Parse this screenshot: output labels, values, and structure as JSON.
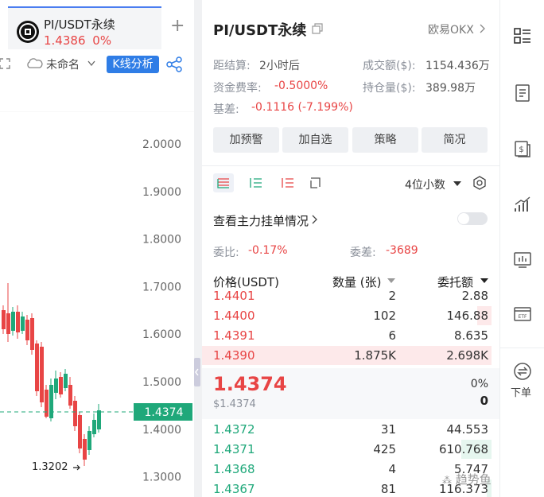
{
  "tab": {
    "symbol": "PI/USDT永续",
    "price": "1.4386",
    "change": "0%"
  },
  "toolbar": {
    "name": "未命名",
    "kline": "K线分析"
  },
  "chart": {
    "y_ticks": [
      "2.0000",
      "1.9000",
      "1.8000",
      "1.7000",
      "1.6000",
      "1.5000",
      "1.4000",
      "1.3000"
    ],
    "current": "1.4374",
    "low_label": "1.3202"
  },
  "header": {
    "symbol": "PI/USDT永续",
    "exchange": "欧易OKX"
  },
  "stats": {
    "settle_label": "距结算:",
    "settle_value": "2小时后",
    "volume_label": "成交额($):",
    "volume_value": "1154.436万",
    "funding_label": "资金费率:",
    "funding_value": "-0.5000%",
    "oi_label": "持仓量($):",
    "oi_value": "389.98万",
    "basis_label": "基差:",
    "basis_value": "-0.1116 (-7.199%)"
  },
  "buttons": [
    "加预警",
    "加自选",
    "策略",
    "简况"
  ],
  "orderbook": {
    "decimals": "4位小数",
    "main_orders": "查看主力挂单情况",
    "ratio_label": "委比:",
    "ratio_value": "-0.17%",
    "diff_label": "委差:",
    "diff_value": "-3689",
    "col_price": "价格(USDT)",
    "col_qty": "数量 (张)",
    "col_total": "委托额",
    "asks": [
      {
        "price": "1.4401",
        "qty": "2",
        "total": "2.88",
        "fill": 0.0
      },
      {
        "price": "1.4400",
        "qty": "102",
        "total": "146.88",
        "fill": 0.05
      },
      {
        "price": "1.4391",
        "qty": "6",
        "total": "8.635",
        "fill": 0.0
      },
      {
        "price": "1.4390",
        "qty": "1.875K",
        "total": "2.698K",
        "fill": 1.0
      }
    ],
    "last_price": "1.4374",
    "last_usd": "$1.4374",
    "pct": "0%",
    "zero": "0",
    "bids": [
      {
        "price": "1.4372",
        "qty": "31",
        "total": "44.553",
        "fill": 0.0
      },
      {
        "price": "1.4371",
        "qty": "425",
        "total": "610.768",
        "fill": 0.32
      },
      {
        "price": "1.4368",
        "qty": "4",
        "total": "5.747",
        "fill": 0.0
      },
      {
        "price": "1.4367",
        "qty": "81",
        "total": "116.373",
        "fill": 0.05
      }
    ]
  },
  "sidebar": {
    "order_label": "下单"
  },
  "watermark": "趋势鱼",
  "colors": {
    "up": "#1fa87a",
    "down": "#e84545",
    "accent": "#2f7de6"
  }
}
